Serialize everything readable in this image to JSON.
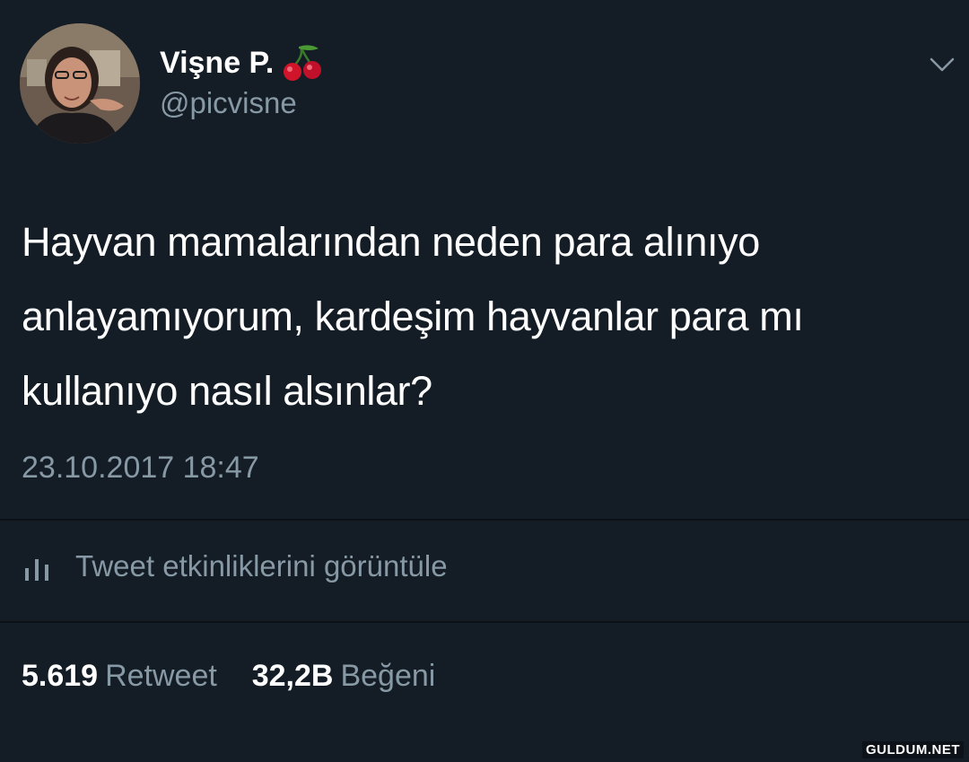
{
  "tweet": {
    "author_name": "Vişne P.",
    "author_emoji_icon": "cherry-icon",
    "handle": "@picvisne",
    "text_lines": [
      "Hayvan mamalarından neden para alınıyo",
      "anlayamıyorum, kardeşim hayvanlar para mı",
      "kullanıyo nasıl alsınlar?"
    ],
    "timestamp": "23.10.2017 18:47",
    "activity_link": "Tweet etkinliklerini görüntüle",
    "retweet_count": "5.619",
    "retweet_label": "Retweet",
    "like_count": "32,2B",
    "like_label": "Beğeni"
  },
  "watermark": "GULDUM.NET",
  "colors": {
    "background": "#141d26",
    "primary_text": "#ffffff",
    "secondary_text": "#8899a6"
  }
}
